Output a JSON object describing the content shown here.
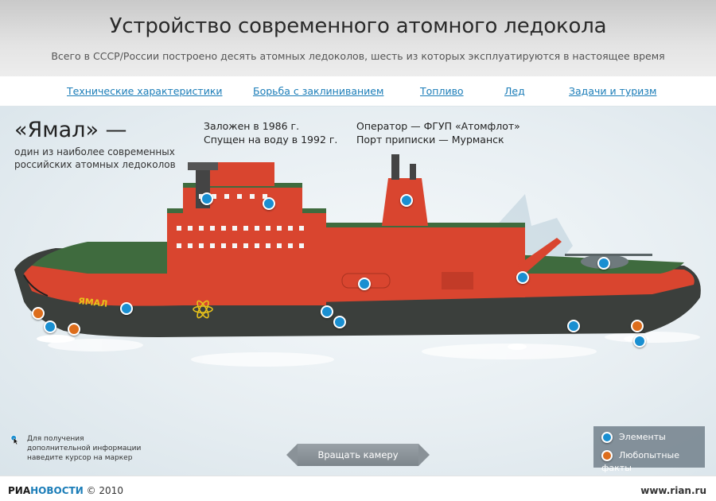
{
  "header": {
    "title": "Устройство современного атомного ледокола",
    "subtitle": "Всего в СССР/России построено десять атомных ледоколов, шесть из которых эксплуатируются в настоящее время"
  },
  "nav": [
    {
      "label": "Технические характеристики"
    },
    {
      "label": "Борьба с заклиниванием"
    },
    {
      "label": "Топливо"
    },
    {
      "label": "Лед"
    },
    {
      "label": "Задачи и туризм"
    }
  ],
  "ship": {
    "name": "«Ямал» —",
    "description": "один из наиболее современных российских атомных ледоколов",
    "hull_label": "ЯМАЛ",
    "laid_down": "Заложен в 1986 г.",
    "launched": "Спущен на воду в 1992 г.",
    "operator": "Оператор — ФГУП «Атомфлот»",
    "home_port": "Порт приписки — Мурманск"
  },
  "markers": {
    "elements_count": 13,
    "facts_count": 4
  },
  "hint": "Для получения дополнительной информации наведите курсор на маркер",
  "rotate_label": "Вращать камеру",
  "legend": {
    "elements": "Элементы",
    "facts": "Любопытные факты"
  },
  "colors": {
    "element_marker": "#1a8fd1",
    "fact_marker": "#dd6d1c",
    "hull_red": "#d9452f",
    "deck_green": "#3f6b3e",
    "link": "#1b7db8"
  },
  "footer": {
    "brand_part1": "РИА",
    "brand_part2": "НОВОСТИ",
    "year": "© 2010",
    "site": "www.rian.ru"
  }
}
